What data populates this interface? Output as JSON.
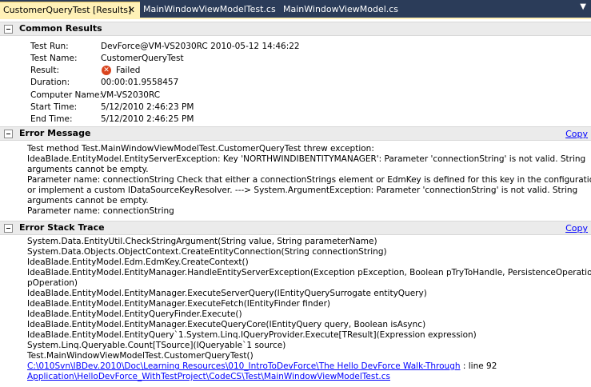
{
  "tabs": [
    {
      "label": "CustomerQueryTest [Results]",
      "active": true
    },
    {
      "label": "MainWindowViewModelTest.cs",
      "active": false
    },
    {
      "label": "MainWindowViewModel.cs",
      "active": false
    }
  ],
  "icons": {
    "close": "close-icon",
    "pin": "pin-icon",
    "failed": "failed-icon",
    "toggle": "collapse-toggle-icon"
  },
  "colors": {
    "tab_strip": "#2b3c59",
    "active_tab": "#fff1b7",
    "link": "#0000ff",
    "failed": "#d9441e"
  },
  "common_results": {
    "title": "Common Results",
    "rows": [
      {
        "label": "Test Run:",
        "value": "DevForce@VM-VS2030RC 2010-05-12 14:46:22"
      },
      {
        "label": "Test Name:",
        "value": "CustomerQueryTest"
      },
      {
        "label": "Result:",
        "value": "Failed"
      },
      {
        "label": "Duration:",
        "value": "00:00:01.9558457"
      },
      {
        "label": "Computer Name:",
        "value": "VM-VS2030RC"
      },
      {
        "label": "Start Time:",
        "value": "5/12/2010 2:46:23 PM"
      },
      {
        "label": "End Time:",
        "value": "5/12/2010 2:46:25 PM"
      }
    ]
  },
  "error_message": {
    "title": "Error Message",
    "copy": "Copy",
    "lines": [
      "Test method Test.MainWindowViewModelTest.CustomerQueryTest threw exception:",
      "IdeaBlade.EntityModel.EntityServerException: Key 'NORTHWINDIBENTITYMANAGER': Parameter 'connectionString' is not valid. String",
      "arguments cannot be empty.",
      "Parameter name: connectionString Check that either a connectionStrings element or EdmKey is defined for this key in the configuration file,",
      "or implement a custom IDataSourceKeyResolver.  ---> System.ArgumentException: Parameter 'connectionString' is not valid. String",
      "arguments cannot be empty.",
      "Parameter name: connectionString"
    ]
  },
  "error_stack": {
    "title": "Error Stack Trace",
    "copy": "Copy",
    "lines": [
      "System.Data.EntityUtil.CheckStringArgument(String value, String parameterName)",
      "System.Data.Objects.ObjectContext.CreateEntityConnection(String connectionString)",
      "IdeaBlade.EntityModel.Edm.EdmKey.CreateContext()",
      "IdeaBlade.EntityModel.EntityManager.HandleEntityServerException(Exception pException, Boolean pTryToHandle, PersistenceOperation",
      "pOperation)",
      "IdeaBlade.EntityModel.EntityManager.ExecuteServerQuery(IEntityQuerySurrogate entityQuery)",
      "IdeaBlade.EntityModel.EntityManager.ExecuteFetch(IEntityFinder finder)",
      "IdeaBlade.EntityModel.EntityQueryFinder.Execute()",
      "IdeaBlade.EntityModel.EntityManager.ExecuteQueryCore(IEntityQuery query, Boolean isAsync)",
      "IdeaBlade.EntityModel.EntityQuery`1.System.Linq.IQueryProvider.Execute[TResult](Expression expression)",
      "System.Linq.Queryable.Count[TSource](IQueryable`1 source)",
      "Test.MainWindowViewModelTest.CustomerQueryTest()"
    ],
    "link_line1": "C:\\010Svn\\IBDev.2010\\Doc\\Learning Resources\\010_IntroToDevForce\\The Hello DevForce Walk-Through",
    "link_suffix": ": line 92",
    "link_line2": "Application\\HelloDevForce_WithTestProject\\CodeCS\\Test\\MainWindowViewModelTest.cs"
  }
}
